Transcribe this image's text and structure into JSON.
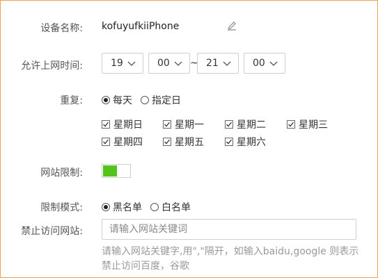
{
  "form": {
    "device_name": {
      "label": "设备名称:",
      "value": "kofuyufkiiPhone",
      "edit_icon": "pencil-icon"
    },
    "allowed_time": {
      "label": "允许上网时间:",
      "start_hour": "19",
      "start_minute": "00",
      "separator": "~",
      "end_hour": "21",
      "end_minute": "00"
    },
    "repeat": {
      "label": "重复:",
      "options": [
        "每天",
        "指定日"
      ],
      "selected": "每天",
      "days": [
        {
          "label": "星期日",
          "checked": true
        },
        {
          "label": "星期一",
          "checked": true
        },
        {
          "label": "星期二",
          "checked": true
        },
        {
          "label": "星期三",
          "checked": true
        },
        {
          "label": "星期四",
          "checked": true
        },
        {
          "label": "星期五",
          "checked": true
        },
        {
          "label": "星期六",
          "checked": true
        }
      ]
    },
    "site_limit": {
      "label": "网站限制:",
      "enabled": true,
      "toggle_color": "#52c41a"
    },
    "limit_mode": {
      "label": "限制模式:",
      "options": [
        "黑名单",
        "白名单"
      ],
      "selected": "黑名单"
    },
    "blocked_sites": {
      "label": "禁止访问网站:",
      "value": "",
      "placeholder": "请输入网站关键词",
      "hint": "请输入网站关键字,用\",\"隔开，如输入baidu,google 则表示禁止访问百度，谷歌"
    }
  },
  "colors": {
    "frame_border": "#f0a14a",
    "toggle_on": "#52c41a"
  }
}
